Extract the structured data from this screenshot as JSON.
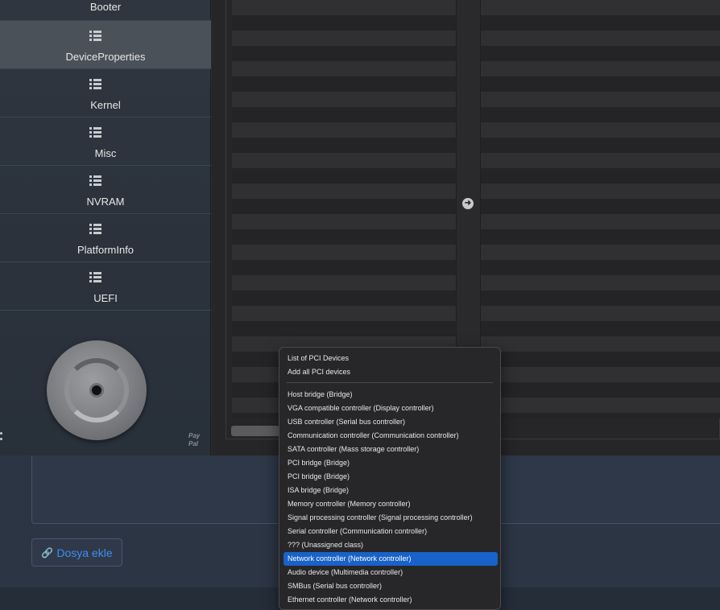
{
  "sidebar": {
    "items": [
      {
        "label": "Booter"
      },
      {
        "label": "DeviceProperties"
      },
      {
        "label": "Kernel"
      },
      {
        "label": "Misc"
      },
      {
        "label": "NVRAM"
      },
      {
        "label": "PlatformInfo"
      },
      {
        "label": "UEFI"
      }
    ],
    "active_item": "DeviceProperties",
    "paypal_line1": "Pay",
    "paypal_line2": "Pal"
  },
  "main": {
    "arrow_icon": "arrow-right-circle-icon",
    "arrow_glyph": "➜"
  },
  "context_menu": {
    "items": [
      {
        "label": "List of PCI Devices"
      },
      {
        "label": "Add all PCI devices"
      },
      {
        "label": "Host bridge (Bridge)"
      },
      {
        "label": "VGA compatible controller (Display controller)"
      },
      {
        "label": "USB controller (Serial bus controller)"
      },
      {
        "label": "Communication controller (Communication controller)"
      },
      {
        "label": "SATA controller (Mass storage controller)"
      },
      {
        "label": "PCI bridge (Bridge)"
      },
      {
        "label": "PCI bridge (Bridge)"
      },
      {
        "label": "ISA bridge (Bridge)"
      },
      {
        "label": "Memory controller (Memory controller)"
      },
      {
        "label": "Signal processing controller (Signal processing controller)"
      },
      {
        "label": "Serial controller (Communication controller)"
      },
      {
        "label": "??? (Unassigned class)"
      },
      {
        "label": "Network controller (Network controller)"
      },
      {
        "label": "Audio device (Multimedia controller)"
      },
      {
        "label": "SMBus (Serial bus controller)"
      },
      {
        "label": "Ethernet controller (Network controller)"
      }
    ],
    "highlighted": "Network controller (Network controller)",
    "highlight_color": "#1862c9"
  },
  "page": {
    "attach_button_label": "Dosya ekle",
    "attach_icon": "paperclip-icon",
    "accent_color": "#3f8ef0"
  }
}
